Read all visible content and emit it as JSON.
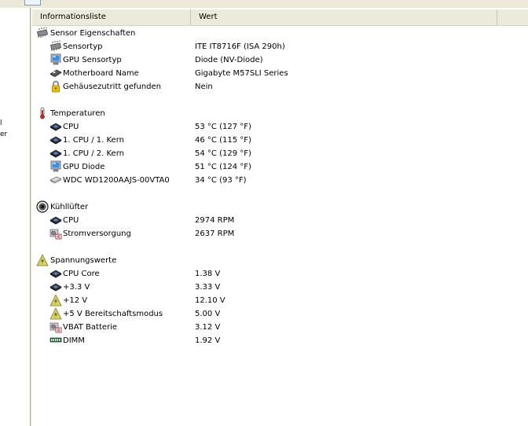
{
  "columns": {
    "name": "Informationsliste",
    "value": "Wert"
  },
  "left_fragments": [
    "l",
    "er"
  ],
  "groups": [
    {
      "title": "Sensor Eigenschaften",
      "icon": "chip-icon",
      "items": [
        {
          "label": "Sensortyp",
          "value": "ITE IT8716F  (ISA 290h)",
          "icon": "chip-icon"
        },
        {
          "label": "GPU Sensortyp",
          "value": "Diode  (NV-Diode)",
          "icon": "monitor-icon"
        },
        {
          "label": "Motherboard Name",
          "value": "Gigabyte M57SLI Series",
          "icon": "motherboard-icon"
        },
        {
          "label": "Gehäusezutritt gefunden",
          "value": "Nein",
          "icon": "lock-icon"
        }
      ]
    },
    {
      "title": "Temperaturen",
      "icon": "thermometer-icon",
      "items": [
        {
          "label": "CPU",
          "value": "53 °C  (127 °F)",
          "icon": "cpu-icon"
        },
        {
          "label": "1. CPU / 1. Kern",
          "value": "46 °C  (115 °F)",
          "icon": "cpu-icon"
        },
        {
          "label": "1. CPU / 2. Kern",
          "value": "54 °C  (129 °F)",
          "icon": "cpu-icon"
        },
        {
          "label": "GPU Diode",
          "value": "51 °C  (124 °F)",
          "icon": "monitor-icon"
        },
        {
          "label": "WDC WD1200AAJS-00VTA0",
          "value": "34 °C  (93 °F)",
          "icon": "harddisk-icon"
        }
      ]
    },
    {
      "title": "Kühllüfter",
      "icon": "fan-icon",
      "items": [
        {
          "label": "CPU",
          "value": "2974 RPM",
          "icon": "cpu-icon"
        },
        {
          "label": "Stromversorgung",
          "value": "2637 RPM",
          "icon": "power-supply-icon"
        }
      ]
    },
    {
      "title": "Spannungswerte",
      "icon": "voltage-icon",
      "items": [
        {
          "label": "CPU Core",
          "value": "1.38 V",
          "icon": "cpu-icon"
        },
        {
          "label": "+3.3 V",
          "value": "3.33 V",
          "icon": "cpu-icon"
        },
        {
          "label": "+12 V",
          "value": "12.10 V",
          "icon": "voltage-icon"
        },
        {
          "label": "+5 V Bereitschaftsmodus",
          "value": "5.00 V",
          "icon": "voltage-icon"
        },
        {
          "label": "VBAT Batterie",
          "value": "3.12 V",
          "icon": "power-supply-icon"
        },
        {
          "label": "DIMM",
          "value": "1.92 V",
          "icon": "ram-icon"
        }
      ]
    }
  ]
}
